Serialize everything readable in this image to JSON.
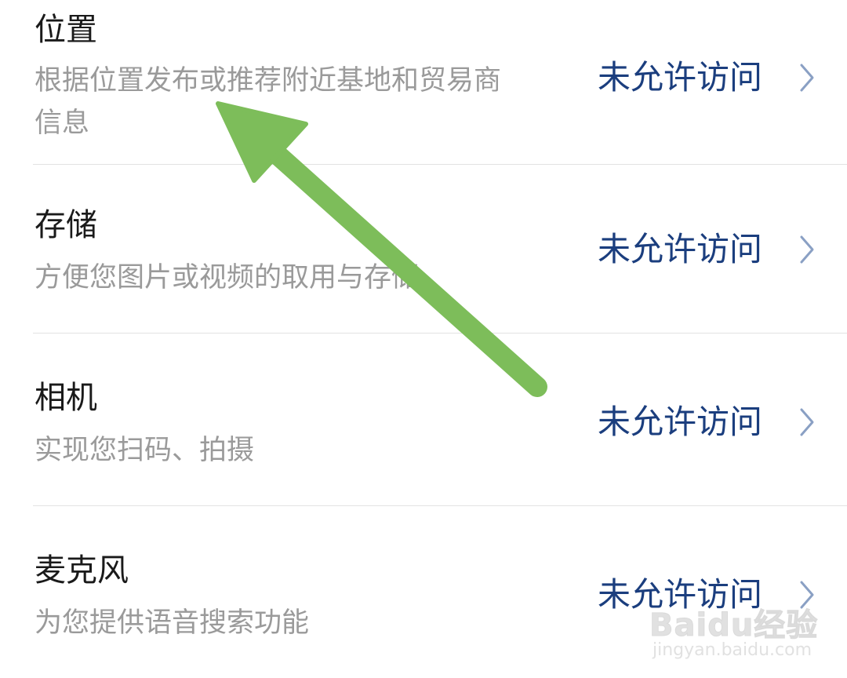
{
  "permissions": [
    {
      "title": "位置",
      "desc_line1": "根据位置发布或推荐附近基地和贸易商",
      "desc_line2": "信息",
      "status": "未允许访问"
    },
    {
      "title": "存储",
      "desc_line1": "方便您图片或视频的取用与存储",
      "desc_line2": "",
      "status": "未允许访问"
    },
    {
      "title": "相机",
      "desc_line1": "实现您扫码、拍摄",
      "desc_line2": "",
      "status": "未允许访问"
    },
    {
      "title": "麦克风",
      "desc_line1": "为您提供语音搜索功能",
      "desc_line2": "",
      "status": "未允许访问"
    }
  ],
  "watermark": {
    "brand": "Baidu经验",
    "site": "jingyan.baidu.com"
  },
  "colors": {
    "title": "#1a1a1a",
    "desc": "#9a9a9a",
    "status": "#1b3e7e",
    "chevron": "#8aa0c4",
    "divider": "#e3e3e3",
    "arrow": "#7dbd5a"
  }
}
